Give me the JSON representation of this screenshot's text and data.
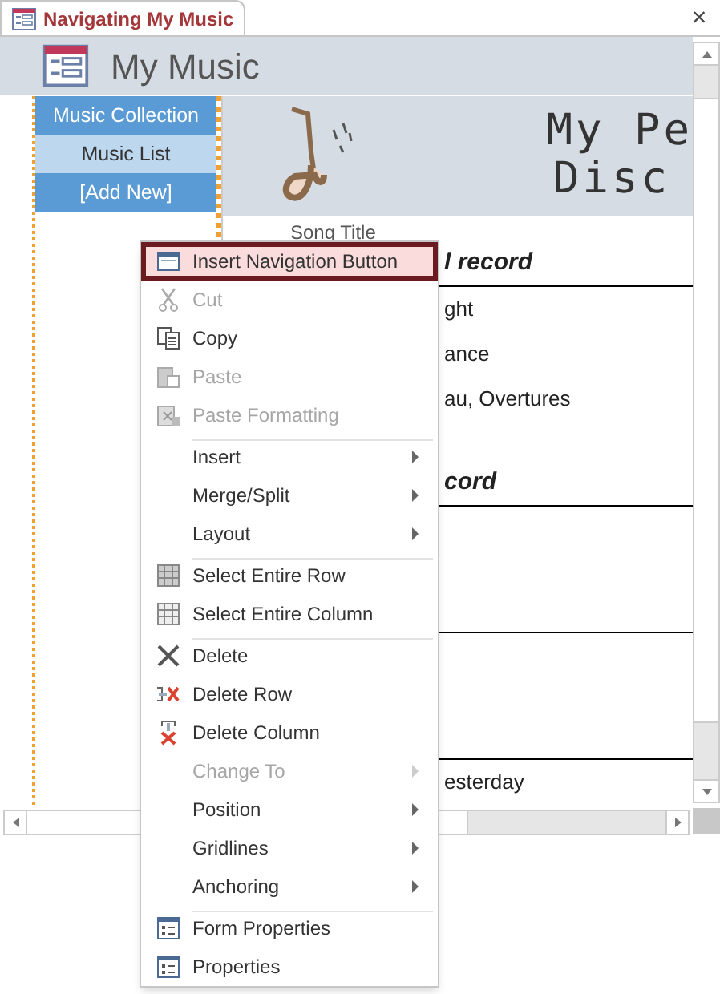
{
  "tab": {
    "title": "Navigating My Music",
    "close": "×"
  },
  "header": {
    "title": "My Music"
  },
  "nav": [
    {
      "label": "Music Collection",
      "selected": false
    },
    {
      "label": "Music List",
      "selected": true
    },
    {
      "label": "[Add New]",
      "selected": false
    }
  ],
  "banner": {
    "title_lines": [
      "My Pe",
      "Disc"
    ]
  },
  "column_label": "Song Title",
  "rows": [
    {
      "kind": "heading",
      "text": "l record"
    },
    {
      "kind": "text",
      "text": "ght"
    },
    {
      "kind": "text",
      "text": "ance"
    },
    {
      "kind": "text",
      "text": "au, Overtures"
    },
    {
      "kind": "blank"
    },
    {
      "kind": "heading",
      "text": "cord"
    },
    {
      "kind": "blank"
    },
    {
      "kind": "blank"
    },
    {
      "kind": "blank"
    },
    {
      "kind": "rule"
    },
    {
      "kind": "blank"
    },
    {
      "kind": "blank"
    },
    {
      "kind": "blank"
    },
    {
      "kind": "rule"
    },
    {
      "kind": "text",
      "text": "esterday"
    }
  ],
  "menu": [
    {
      "label": "Insert Navigation Button",
      "selected": true,
      "disabled": false,
      "submenu": false,
      "separator_before": false
    },
    {
      "label": "Cut",
      "selected": false,
      "disabled": true,
      "submenu": false,
      "separator_before": false
    },
    {
      "label": "Copy",
      "selected": false,
      "disabled": false,
      "submenu": false,
      "separator_before": false
    },
    {
      "label": "Paste",
      "selected": false,
      "disabled": true,
      "submenu": false,
      "separator_before": false
    },
    {
      "label": "Paste Formatting",
      "selected": false,
      "disabled": true,
      "submenu": false,
      "separator_before": false
    },
    {
      "label": "Insert",
      "selected": false,
      "disabled": false,
      "submenu": true,
      "separator_before": true
    },
    {
      "label": "Merge/Split",
      "selected": false,
      "disabled": false,
      "submenu": true,
      "separator_before": false
    },
    {
      "label": "Layout",
      "selected": false,
      "disabled": false,
      "submenu": true,
      "separator_before": false
    },
    {
      "label": "Select Entire Row",
      "selected": false,
      "disabled": false,
      "submenu": false,
      "separator_before": true
    },
    {
      "label": "Select Entire Column",
      "selected": false,
      "disabled": false,
      "submenu": false,
      "separator_before": false
    },
    {
      "label": "Delete",
      "selected": false,
      "disabled": false,
      "submenu": false,
      "separator_before": true
    },
    {
      "label": "Delete Row",
      "selected": false,
      "disabled": false,
      "submenu": false,
      "separator_before": false
    },
    {
      "label": "Delete Column",
      "selected": false,
      "disabled": false,
      "submenu": false,
      "separator_before": false
    },
    {
      "label": "Change To",
      "selected": false,
      "disabled": true,
      "submenu": true,
      "separator_before": false
    },
    {
      "label": "Position",
      "selected": false,
      "disabled": false,
      "submenu": true,
      "separator_before": false
    },
    {
      "label": "Gridlines",
      "selected": false,
      "disabled": false,
      "submenu": true,
      "separator_before": false
    },
    {
      "label": "Anchoring",
      "selected": false,
      "disabled": false,
      "submenu": true,
      "separator_before": false
    },
    {
      "label": "Form Properties",
      "selected": false,
      "disabled": false,
      "submenu": false,
      "separator_before": true
    },
    {
      "label": "Properties",
      "selected": false,
      "disabled": false,
      "submenu": false,
      "separator_before": false
    }
  ]
}
